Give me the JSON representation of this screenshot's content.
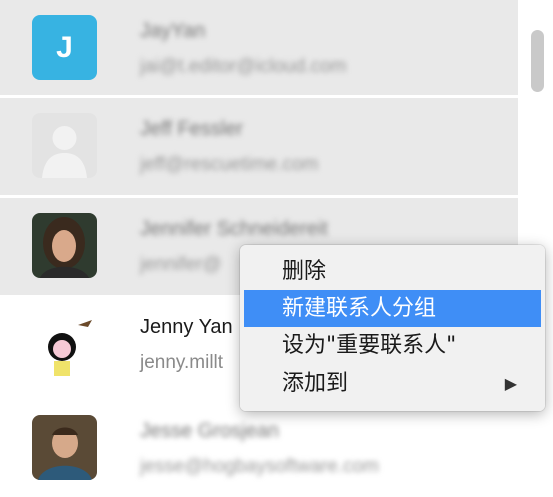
{
  "contacts": [
    {
      "name": "JayYan",
      "email": "jai@t.editor@icloud.com",
      "avatar": "letter",
      "avatar_letter": "J",
      "selected": true
    },
    {
      "name": "Jeff Fessler",
      "email": "jeff@rescuetime.com",
      "avatar": "generic-silhouette",
      "selected": true
    },
    {
      "name": "Jennifer Schneidereit",
      "email": "jennifer@",
      "avatar": "photo",
      "selected": true
    },
    {
      "name": "Jenny Yan",
      "email": "jenny.millt",
      "avatar": "cartoon",
      "selected": false
    },
    {
      "name": "Jesse Grosjean",
      "email": "jesse@hogbaysoftware.com",
      "avatar": "photo",
      "selected": false
    }
  ],
  "context_menu": {
    "items": [
      {
        "label": "删除",
        "highlighted": false
      },
      {
        "label": "新建联系人分组",
        "highlighted": true
      },
      {
        "label": "设为\"重要联系人\"",
        "highlighted": false
      },
      {
        "label": "添加到",
        "highlighted": false,
        "submenu_arrow": "▶"
      }
    ]
  },
  "colors": {
    "selection_bg": "#e9e9e9",
    "menu_highlight": "#3f8ef6",
    "letter_avatar_bg": "#37b3e2"
  }
}
